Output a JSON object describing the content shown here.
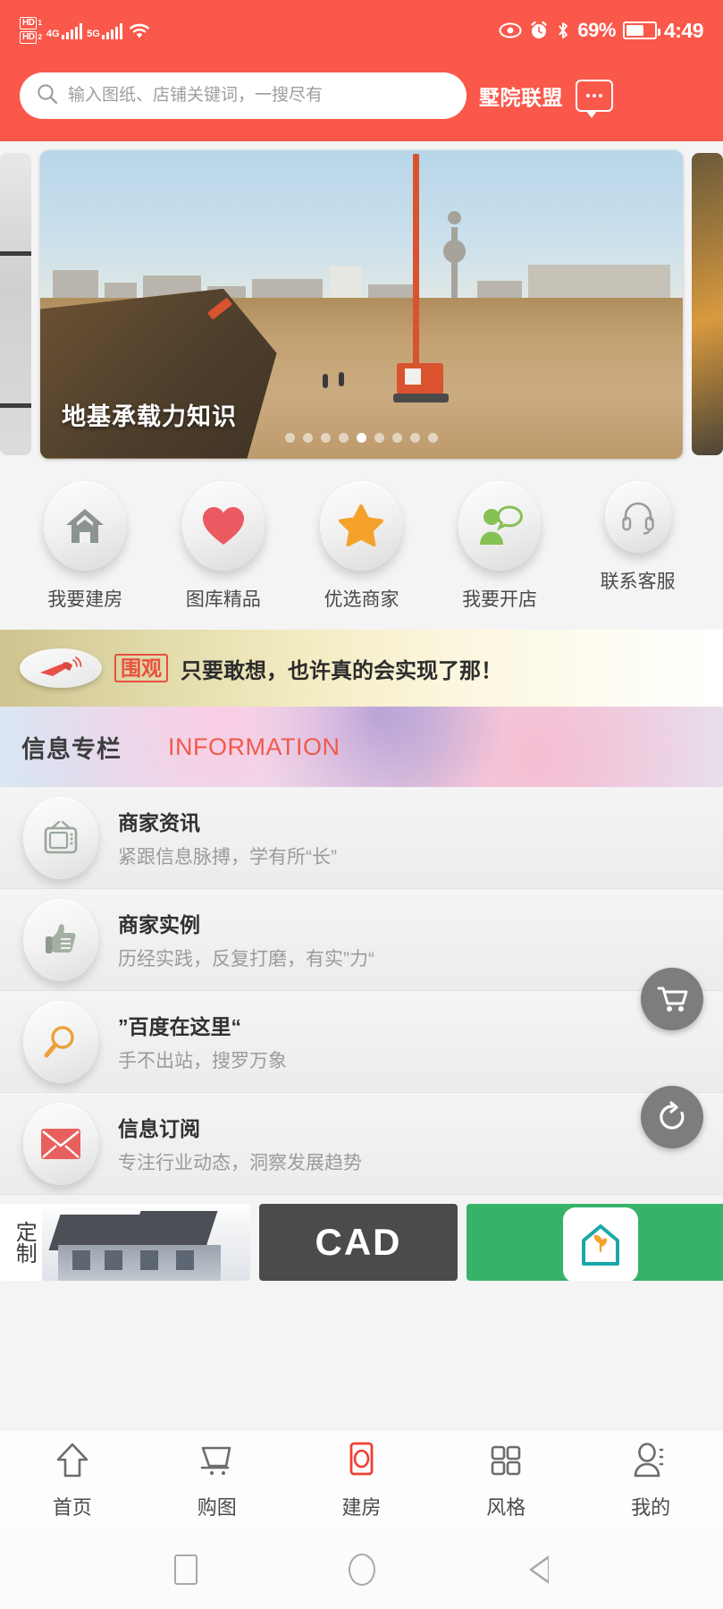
{
  "statusbar": {
    "network_1": "HD",
    "network_1_sub": "1",
    "network_2": "HD",
    "network_2_sub": "2",
    "gen_1": "4G",
    "gen_2": "5G",
    "battery_percent": "69%",
    "time": "4:49",
    "icons": [
      "eye-icon",
      "alarm-icon",
      "bluetooth-icon",
      "battery-icon",
      "wifi-icon",
      "signal-icon"
    ]
  },
  "search": {
    "placeholder": "输入图纸、店铺关键词，一搜尽有",
    "value": "",
    "brand": "墅院联盟"
  },
  "carousel": {
    "caption": "地基承载力知识",
    "dot_count": 9,
    "active_dot": 4
  },
  "quick_actions": [
    {
      "label": "我要建房",
      "icon": "home-icon",
      "color": "#8b9490"
    },
    {
      "label": "图库精品",
      "icon": "heart-icon",
      "color": "#ea5a60"
    },
    {
      "label": "优选商家",
      "icon": "star-icon",
      "color": "#f4a22c"
    },
    {
      "label": "我要开店",
      "icon": "person-speech-icon",
      "color": "#86c153"
    },
    {
      "label": "联系客服",
      "icon": "headset-icon",
      "color": "#9a9a9a"
    }
  ],
  "notice": {
    "badge": "围观",
    "text": "只要敢想，也许真的会实现了那！",
    "icon": "megaphone-icon"
  },
  "info_section": {
    "title_cn": "信息专栏",
    "title_en": "INFORMATION",
    "rows": [
      {
        "title": "商家资讯",
        "subtitle": "紧跟信息脉搏，学有所“长”",
        "icon": "tv-icon",
        "color": "#9aa79c"
      },
      {
        "title": "商家实例",
        "subtitle": "历经实践，反复打磨，有实”力“",
        "icon": "thumbs-up-icon",
        "color": "#92a092"
      },
      {
        "title": "”百度在这里“",
        "subtitle": "手不出站，搜罗万象",
        "icon": "magnifier-icon",
        "color": "#eba23c"
      },
      {
        "title": "信息订阅",
        "subtitle": "专注行业动态，洞察发展趋势",
        "icon": "envelope-icon",
        "color": "#e8605e"
      }
    ]
  },
  "floating_buttons": [
    {
      "name": "cart-fab",
      "icon": "cart-icon",
      "color": "#7d7d7d"
    },
    {
      "name": "refresh-fab",
      "icon": "refresh-icon",
      "color": "#7d7d7d"
    }
  ],
  "card_strip": [
    {
      "name": "custom-card",
      "label": "定制",
      "icon": "house-render"
    },
    {
      "name": "cad-card",
      "label": "CAD",
      "icon": "cad-text"
    },
    {
      "name": "green-card",
      "label": "",
      "icon": "house-plant-icon"
    }
  ],
  "tabbar": {
    "active_index": 2,
    "active_color": "#ef4036",
    "items": [
      {
        "label": "首页",
        "icon": "home-outline-icon"
      },
      {
        "label": "购图",
        "icon": "cart-outline-icon"
      },
      {
        "label": "建房",
        "icon": "build-house-icon"
      },
      {
        "label": "风格",
        "icon": "grid-icon"
      },
      {
        "label": "我的",
        "icon": "profile-icon"
      }
    ]
  },
  "android_nav": {
    "items": [
      {
        "name": "recents",
        "icon": "square-icon"
      },
      {
        "name": "home",
        "icon": "circle-icon"
      },
      {
        "name": "back",
        "icon": "triangle-back-icon"
      }
    ]
  },
  "colors": {
    "brand_red": "#f9584a",
    "accent_coral": "#f05a4a",
    "page_bg": "#f4f4f4"
  }
}
